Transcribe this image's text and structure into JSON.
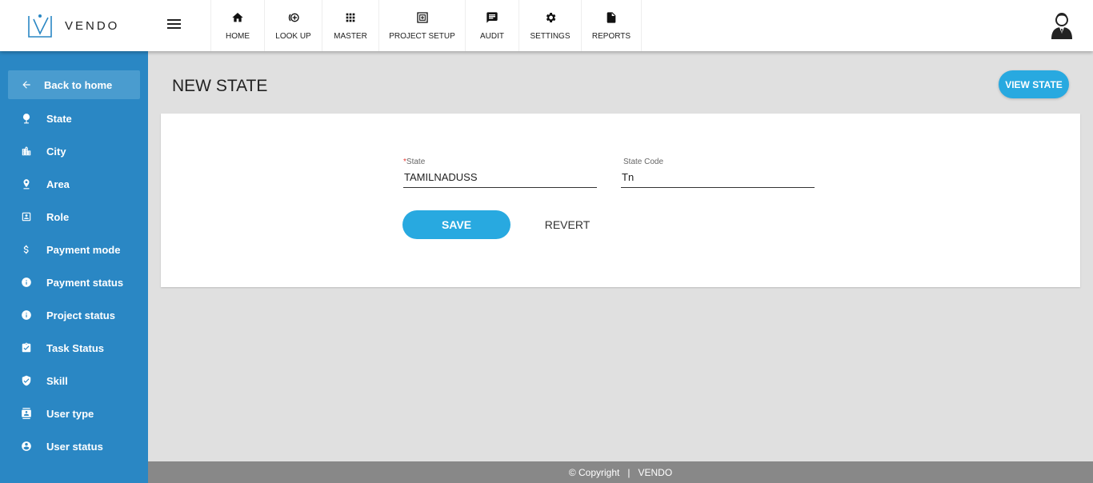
{
  "app": {
    "brand": "VENDO"
  },
  "topnav": {
    "tabs": [
      {
        "label": "HOME",
        "icon": "home-icon"
      },
      {
        "label": "LOOK UP",
        "icon": "lookup-icon"
      },
      {
        "label": "MASTER",
        "icon": "grid-icon"
      },
      {
        "label": "PROJECT SETUP",
        "icon": "project-icon"
      },
      {
        "label": "AUDIT",
        "icon": "chat-icon"
      },
      {
        "label": "SETTINGS",
        "icon": "gear-icon"
      },
      {
        "label": "REPORTS",
        "icon": "document-icon"
      }
    ]
  },
  "sidebar": {
    "back_label": "Back to home",
    "items": [
      {
        "label": "State",
        "icon": "pin-icon"
      },
      {
        "label": "City",
        "icon": "city-icon"
      },
      {
        "label": "Area",
        "icon": "location-icon"
      },
      {
        "label": "Role",
        "icon": "badge-icon"
      },
      {
        "label": "Payment mode",
        "icon": "dollar-icon"
      },
      {
        "label": "Payment status",
        "icon": "info-icon"
      },
      {
        "label": "Project status",
        "icon": "info-icon"
      },
      {
        "label": "Task Status",
        "icon": "clipboard-check-icon"
      },
      {
        "label": "Skill",
        "icon": "shield-check-icon"
      },
      {
        "label": "User type",
        "icon": "contact-card-icon"
      },
      {
        "label": "User status",
        "icon": "account-circle-icon"
      }
    ]
  },
  "main": {
    "title": "NEW STATE",
    "view_button": "VIEW STATE",
    "form": {
      "state": {
        "required_mark": "*",
        "label": "State",
        "value": "TAMILNADUSS"
      },
      "state_code": {
        "label": "State Code",
        "value": "Tn"
      },
      "save_label": "SAVE",
      "revert_label": "REVERT"
    }
  },
  "footer": {
    "text": "© Copyright   |   VENDO"
  },
  "colors": {
    "sidebar": "#2a87c4",
    "accent": "#28a9e0",
    "footer": "#888888"
  }
}
